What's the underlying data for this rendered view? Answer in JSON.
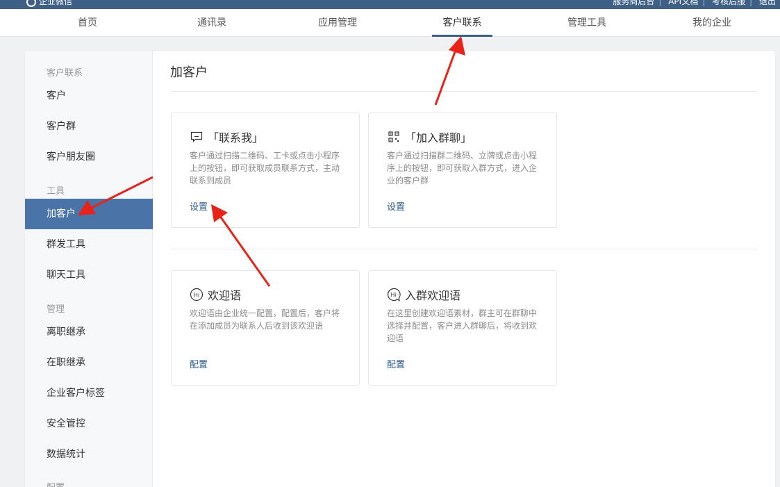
{
  "topbar": {
    "logo": "企业微信",
    "links": [
      "服务商后台",
      "API文档",
      "考核后服",
      "退出"
    ]
  },
  "nav": {
    "tabs": [
      "首页",
      "通讯录",
      "应用管理",
      "客户联系",
      "管理工具",
      "我的企业"
    ],
    "active": "客户联系"
  },
  "sidebar": {
    "section_customer": "客户联系",
    "customer_items": [
      "客户",
      "客户群",
      "客户朋友圈"
    ],
    "section_tools": "工具",
    "tool_items": [
      "加客户",
      "群发工具",
      "聊天工具"
    ],
    "section_manage": "管理",
    "manage_items": [
      "离职继承",
      "在职继承",
      "企业客户标签",
      "安全管控",
      "数据统计"
    ],
    "section_config": "配置",
    "active": "加客户"
  },
  "main": {
    "title": "加客户",
    "cards": [
      {
        "icon": "message-icon",
        "title": "「联系我」",
        "desc": "客户通过扫描二维码、工卡或点击小程序上的按钮，即可获取成员联系方式，主动联系到成员",
        "link": "设置"
      },
      {
        "icon": "qrcode-icon",
        "title": "「加入群聊」",
        "desc": "客户通过扫描群二维码、立牌或点击小程序上的按钮，即可获取入群方式，进入企业的客户群",
        "link": "设置"
      },
      {
        "icon": "hi-icon",
        "title": "欢迎语",
        "desc": "欢迎语由企业统一配置，配置后，客户将在添加成员为联系人后收到该欢迎语",
        "link": "配置"
      },
      {
        "icon": "hi-chat-icon",
        "title": "入群欢迎语",
        "desc": "在这里创建欢迎语素材，群主可在群聊中选择并配置，客户进入群聊后，将收到欢迎语",
        "link": "配置"
      }
    ]
  },
  "colors": {
    "topbar": "#3e5f86",
    "active_sidebar": "#4a74a8",
    "link": "#2a5b8c",
    "annotation": "#e8231a"
  }
}
